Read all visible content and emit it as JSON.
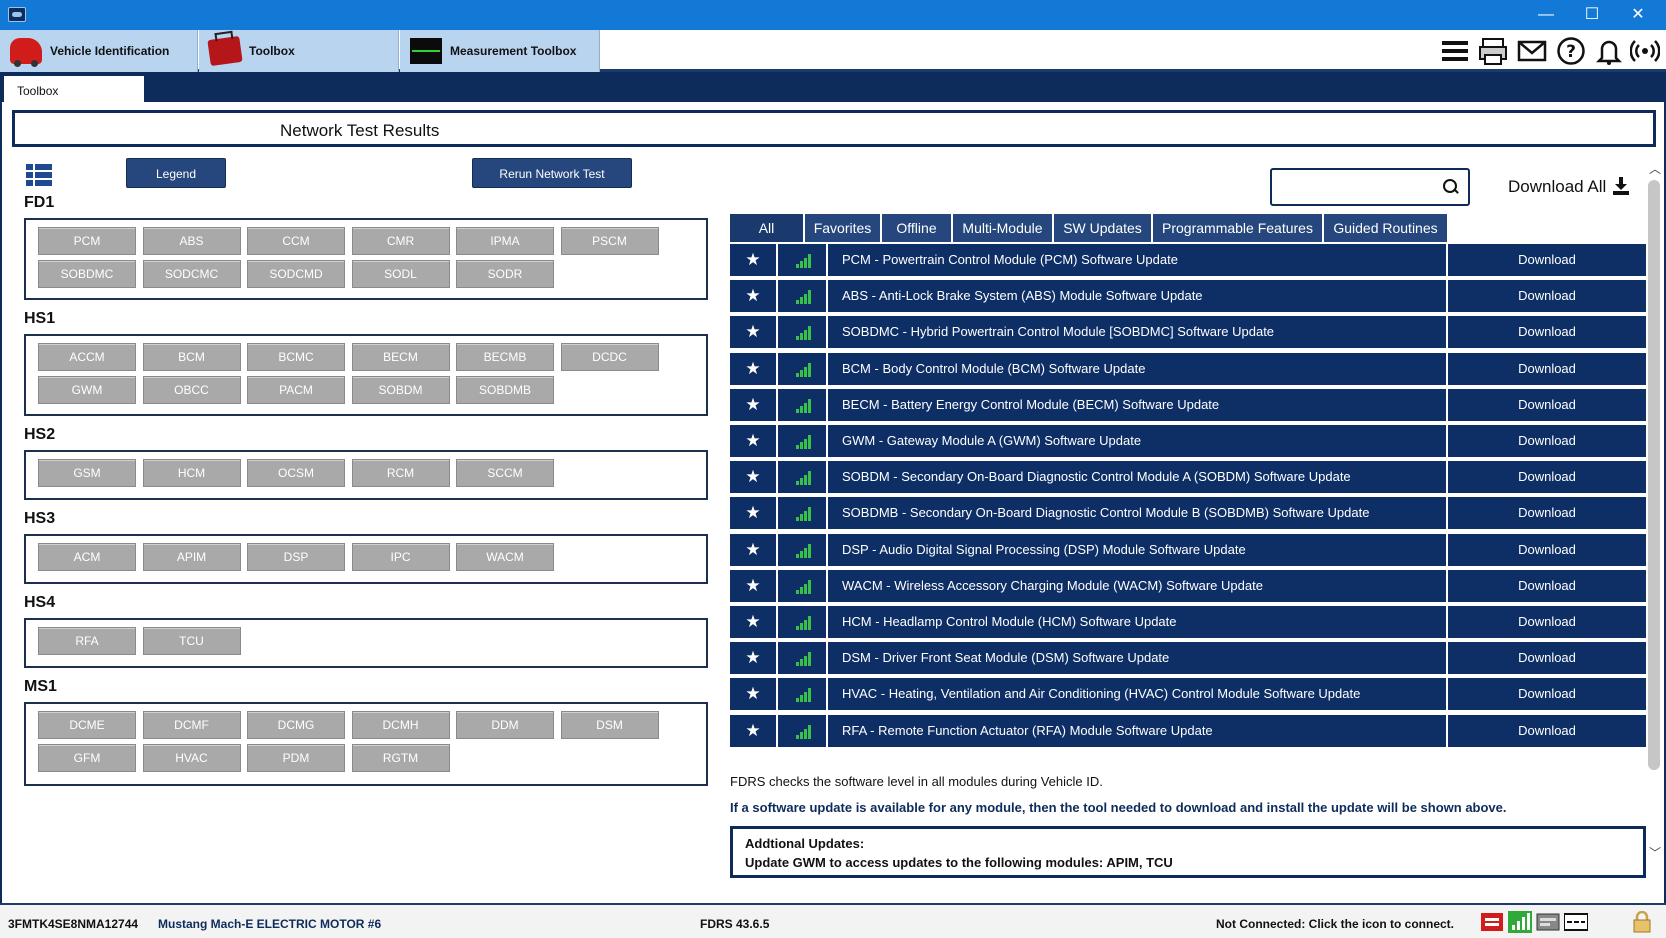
{
  "window": {
    "minimize": "—",
    "maximize": "☐",
    "close": "✕"
  },
  "top_tabs": [
    {
      "label": "Vehicle Identification"
    },
    {
      "label": "Toolbox"
    },
    {
      "label": "Measurement Toolbox"
    }
  ],
  "subtab": {
    "label": "Toolbox"
  },
  "page": {
    "title": "Network Test Results",
    "legend_button": "Legend",
    "rerun_button": "Rerun Network Test"
  },
  "groups": [
    {
      "name": "FD1",
      "modules": [
        "PCM",
        "ABS",
        "CCM",
        "CMR",
        "IPMA",
        "PSCM",
        "SOBDMC",
        "SODCMC",
        "SODCMD",
        "SODL",
        "SODR"
      ]
    },
    {
      "name": "HS1",
      "modules": [
        "ACCM",
        "BCM",
        "BCMC",
        "BECM",
        "BECMB",
        "DCDC",
        "GWM",
        "OBCC",
        "PACM",
        "SOBDM",
        "SOBDMB"
      ]
    },
    {
      "name": "HS2",
      "modules": [
        "GSM",
        "HCM",
        "OCSM",
        "RCM",
        "SCCM"
      ]
    },
    {
      "name": "HS3",
      "modules": [
        "ACM",
        "APIM",
        "DSP",
        "IPC",
        "WACM"
      ]
    },
    {
      "name": "HS4",
      "modules": [
        "RFA",
        "TCU"
      ]
    },
    {
      "name": "MS1",
      "modules": [
        "DCME",
        "DCMF",
        "DCMG",
        "DCMH",
        "DDM",
        "DSM",
        "GFM",
        "HVAC",
        "PDM",
        "RGTM"
      ]
    }
  ],
  "search": {
    "placeholder": ""
  },
  "download_all": "Download All",
  "filter_tabs": [
    "All",
    "Favorites",
    "Offline",
    "Multi-Module",
    "SW Updates",
    "Programmable Features",
    "Guided Routines"
  ],
  "updates": [
    {
      "name": "PCM - Powertrain Control Module (PCM) Software Update",
      "action": "Download"
    },
    {
      "name": "ABS - Anti-Lock Brake System (ABS) Module Software Update",
      "action": "Download"
    },
    {
      "name": "SOBDMC - Hybrid Powertrain Control Module [SOBDMC] Software Update",
      "action": "Download"
    },
    {
      "name": "BCM - Body Control Module (BCM) Software Update",
      "action": "Download"
    },
    {
      "name": "BECM - Battery Energy Control Module (BECM) Software Update",
      "action": "Download"
    },
    {
      "name": "GWM - Gateway Module A (GWM) Software Update",
      "action": "Download"
    },
    {
      "name": "SOBDM - Secondary On-Board Diagnostic Control Module A (SOBDM) Software Update",
      "action": "Download"
    },
    {
      "name": "SOBDMB - Secondary On-Board Diagnostic Control Module B (SOBDMB) Software Update",
      "action": "Download"
    },
    {
      "name": "DSP - Audio Digital Signal Processing (DSP) Module Software Update",
      "action": "Download"
    },
    {
      "name": "WACM - Wireless Accessory Charging Module (WACM) Software Update",
      "action": "Download"
    },
    {
      "name": "HCM - Headlamp Control Module (HCM) Software Update",
      "action": "Download"
    },
    {
      "name": "DSM - Driver Front Seat Module (DSM) Software Update",
      "action": "Download"
    },
    {
      "name": "HVAC - Heating, Ventilation and Air Conditioning (HVAC) Control Module Software Update",
      "action": "Download"
    },
    {
      "name": "RFA - Remote Function Actuator (RFA) Module Software Update",
      "action": "Download"
    }
  ],
  "notes": {
    "line1": "FDRS checks the software level in all modules during Vehicle ID.",
    "line2": "If a software update is available for any module, then the tool needed to download and install the update will be shown above."
  },
  "additional": {
    "title": "Addtional Updates:",
    "text": "Update GWM to access updates to the following modules: APIM, TCU"
  },
  "status": {
    "vin": "3FMTK4SE8NMA12744",
    "vehicle": "Mustang Mach-E ELECTRIC MOTOR #6",
    "version": "FDRS 43.6.5",
    "connection": "Not Connected: Click the icon to connect."
  },
  "colors": {
    "navy": "#0e2f66",
    "accent": "#1279d6",
    "module_gray": "#a9a9a9",
    "signal_green": "#38c14a"
  }
}
